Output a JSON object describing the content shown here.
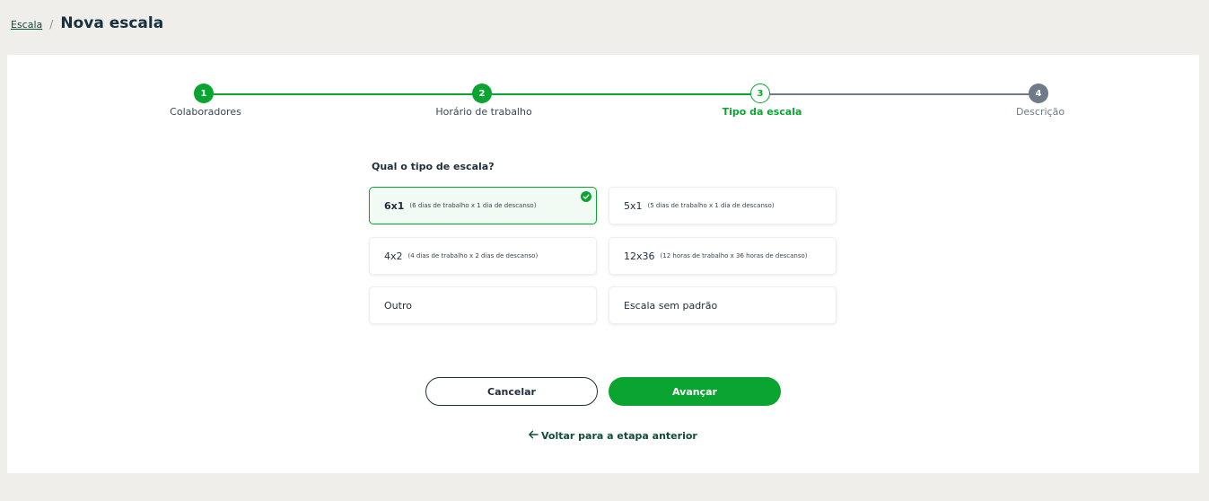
{
  "breadcrumb": {
    "link": "Escala",
    "separator": "/",
    "title": "Nova escala"
  },
  "stepper": {
    "steps": [
      {
        "number": "1",
        "label": "Colaboradores",
        "state": "done"
      },
      {
        "number": "2",
        "label": "Horário de trabalho",
        "state": "done"
      },
      {
        "number": "3",
        "label": "Tipo da escala",
        "state": "current"
      },
      {
        "number": "4",
        "label": "Descrição",
        "state": "todo"
      }
    ]
  },
  "form": {
    "question": "Qual o tipo de escala?",
    "options": [
      {
        "main": "6x1",
        "sub": "(6 dias de trabalho x 1 dia de descanso)",
        "selected": true
      },
      {
        "main": "5x1",
        "sub": "(5 dias de trabalho x 1 dia de descanso)",
        "selected": false
      },
      {
        "main": "4x2",
        "sub": "(4 dias de trabalho x 2 dias de descanso)",
        "selected": false
      },
      {
        "main": "12x36",
        "sub": "(12 horas de trabalho x 36 horas de descanso)",
        "selected": false
      },
      {
        "main": "Outro",
        "sub": "",
        "selected": false
      },
      {
        "main": "Escala sem padrão",
        "sub": "",
        "selected": false
      }
    ]
  },
  "actions": {
    "cancel_label": "Cancelar",
    "next_label": "Avançar",
    "back_label": "Voltar para a etapa anterior"
  },
  "colors": {
    "accent": "#0aa530",
    "pending": "#6f7b88",
    "background": "#efeeea"
  },
  "icons": {
    "selected": "check-circle-icon",
    "back": "arrow-left-icon"
  }
}
